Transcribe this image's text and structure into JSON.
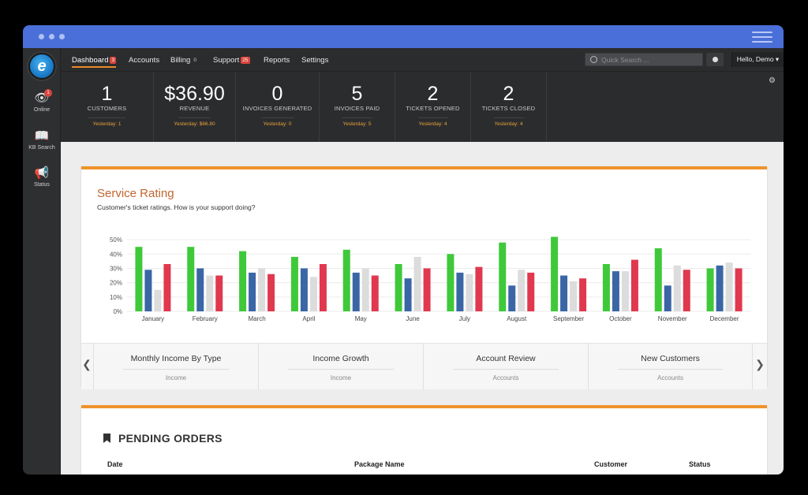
{
  "nav": {
    "items": [
      {
        "label": "Dashboard",
        "badge": "3",
        "active": true
      },
      {
        "label": "Accounts"
      },
      {
        "label": "Billing",
        "badge": "0"
      },
      {
        "label": "Support",
        "badge": "25"
      },
      {
        "label": "Reports"
      },
      {
        "label": "Settings"
      }
    ],
    "search_placeholder": "Quick Search ...",
    "user_menu": "Hello, Demo ▾"
  },
  "sidebar": {
    "logo_letter": "e",
    "items": [
      {
        "label": "Online",
        "icon": "eye-icon",
        "badge": "1"
      },
      {
        "label": "KB Search",
        "icon": "book-icon"
      },
      {
        "label": "Status",
        "icon": "megaphone-icon"
      }
    ]
  },
  "stats": [
    {
      "value": "1",
      "label": "CUSTOMERS",
      "yesterday": "Yesterday: 1"
    },
    {
      "value": "$36.90",
      "label": "REVENUE",
      "yesterday": "Yesterday: $66.80"
    },
    {
      "value": "0",
      "label": "INVOICES GENERATED",
      "yesterday": "Yesterday: 0"
    },
    {
      "value": "5",
      "label": "INVOICES PAID",
      "yesterday": "Yesterday: 5"
    },
    {
      "value": "2",
      "label": "TICKETS OPENED",
      "yesterday": "Yesterday: 4"
    },
    {
      "value": "2",
      "label": "TICKETS CLOSED",
      "yesterday": "Yesterday: 4"
    }
  ],
  "service_rating": {
    "title": "Service Rating",
    "subtitle": "Customer's ticket ratings. How is your support doing?"
  },
  "chart_data": {
    "type": "bar",
    "categories": [
      "January",
      "February",
      "March",
      "April",
      "May",
      "June",
      "July",
      "August",
      "September",
      "October",
      "November",
      "December"
    ],
    "yticks": [
      "50%",
      "40%",
      "30%",
      "20%",
      "10%",
      "0%"
    ],
    "ytick_values": [
      50,
      40,
      30,
      20,
      10,
      0
    ],
    "ylim": [
      0,
      55
    ],
    "grid": true,
    "colors": [
      "#3fc93a",
      "#3b66a6",
      "#dcdcdc",
      "#e0384f"
    ],
    "series": [
      {
        "values": [
          45,
          45,
          42,
          38,
          43,
          33,
          40,
          48,
          52,
          33,
          44,
          30
        ]
      },
      {
        "values": [
          29,
          30,
          27,
          30,
          27,
          23,
          27,
          18,
          25,
          28,
          18,
          32
        ]
      },
      {
        "values": [
          15,
          25,
          30,
          24,
          30,
          38,
          26,
          29,
          21,
          28,
          32,
          34
        ]
      },
      {
        "values": [
          33,
          25,
          26,
          33,
          25,
          30,
          31,
          27,
          23,
          36,
          29,
          30
        ]
      }
    ]
  },
  "carousel": [
    {
      "title": "Monthly Income By Type",
      "subtitle": "Income"
    },
    {
      "title": "Income Growth",
      "subtitle": "Income"
    },
    {
      "title": "Account Review",
      "subtitle": "Accounts"
    },
    {
      "title": "New Customers",
      "subtitle": "Accounts"
    }
  ],
  "pending_orders": {
    "title": "PENDING ORDERS",
    "columns": [
      "Date",
      "Package Name",
      "Customer",
      "Status"
    ]
  }
}
